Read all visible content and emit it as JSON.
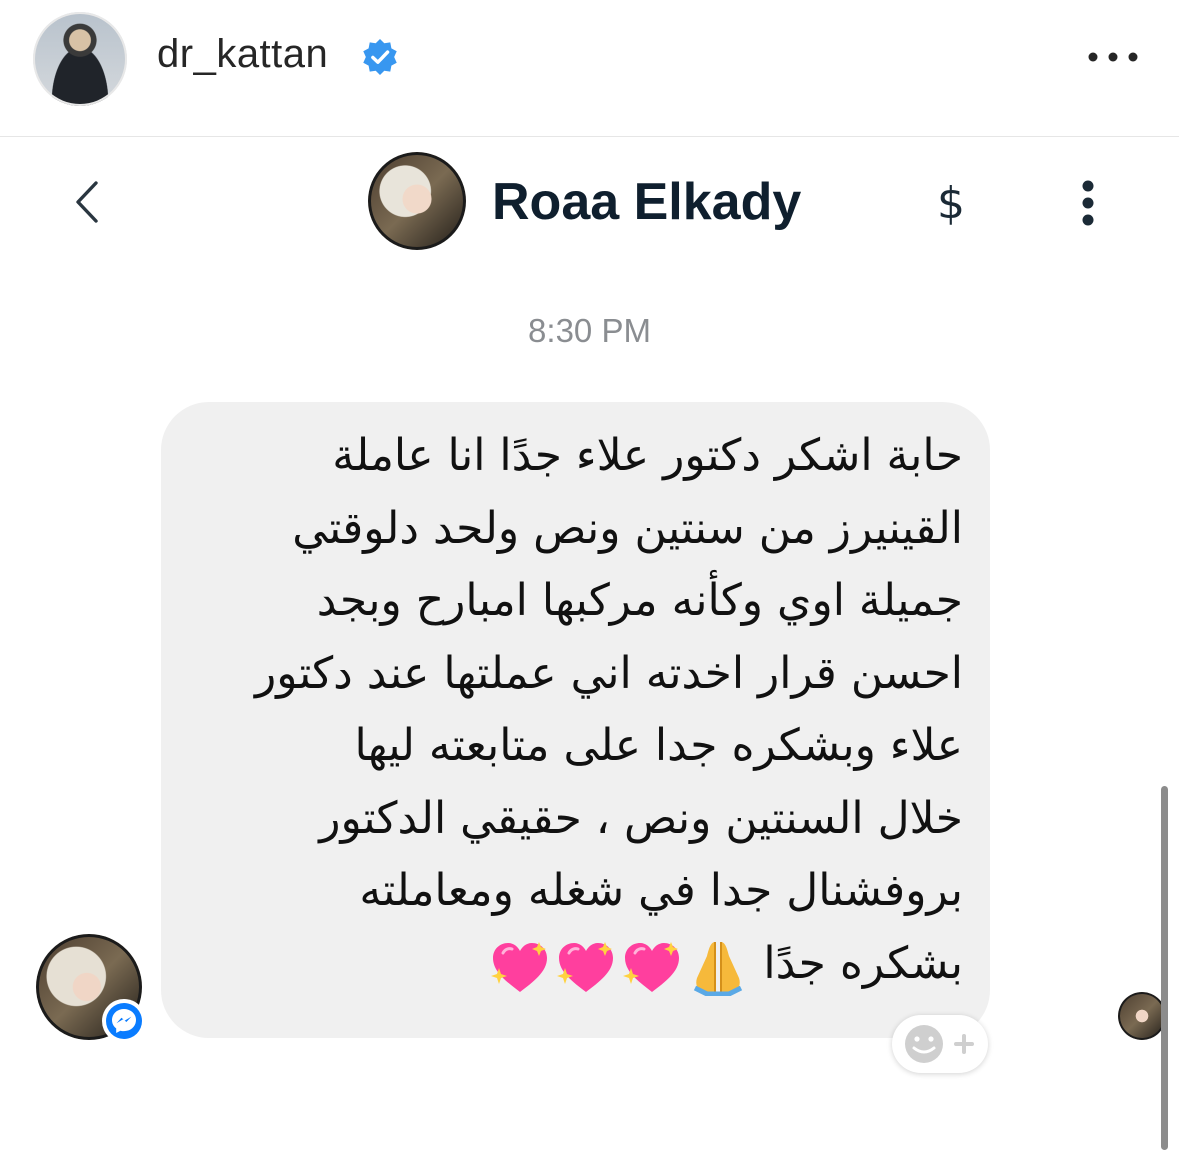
{
  "post_header": {
    "username": "dr_kattan",
    "verified": true,
    "icons": {
      "avatar": "profile-avatar",
      "verified": "verified-badge-icon",
      "more": "more-horizontal-icon"
    },
    "accent_color": "#3897f0"
  },
  "chat_header": {
    "contact_name": "Roaa Elkady",
    "dollar_label": "$",
    "icons": {
      "back": "chevron-left-icon",
      "payment": "dollar-icon",
      "options": "more-vertical-icon"
    }
  },
  "conversation": {
    "timestamp": "8:30 PM",
    "message": {
      "lines": [
        "حابة اشكر دكتور علاء جدًا انا عاملة",
        "القينيرز من سنتين ونص ولحد دلوقتي",
        "جميلة اوي وكأنه مركبها امبارح وبجد",
        "احسن قرار اخدته اني عملتها عند دكتور",
        "علاء وبشكره جدا على متابعته ليها",
        "خلال السنتين ونص ، حقيقي الدكتور",
        "بروفشنال جدا في شغله ومعاملته",
        "بشكره جدًا"
      ],
      "emojis": [
        "folded-hands-icon",
        "sparkling-heart-icon",
        "sparkling-heart-icon",
        "sparkling-heart-icon"
      ],
      "bubble_color": "#f0f0f0"
    },
    "badge": "messenger-icon",
    "reaction_button": "add-reaction-icon",
    "messenger_color": "#0a7cff"
  }
}
